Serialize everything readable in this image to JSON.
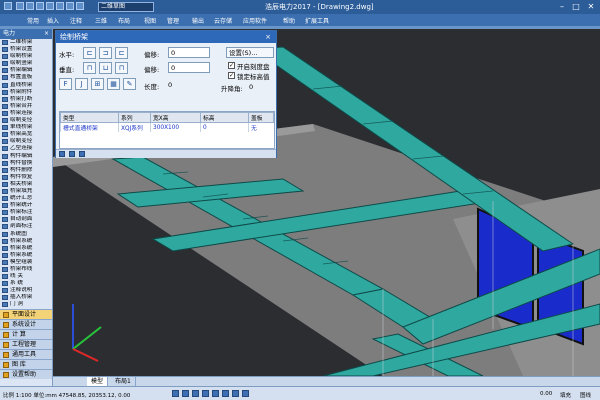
{
  "app": {
    "title": "浩辰电力2017 - [Drawing2.dwg]",
    "doc_dropdown": "二维草图",
    "win_min": "–",
    "win_max": "□",
    "win_close": "✕"
  },
  "menu": [
    "常用",
    "插入",
    "注释",
    "三维",
    "布局",
    "视图",
    "管理",
    "输出",
    "云存储",
    "应用软件",
    "帮助",
    "扩展工具"
  ],
  "sidebar": {
    "header": "电力",
    "close": "×",
    "items": [
      "二维桥架",
      "桥架设置",
      "绘制桥架",
      "绘制竖架",
      "桥架编辑",
      "布置盖板",
      "直线桥架",
      "桥架附件",
      "桥架打断",
      "桥架合并",
      "桥架连接",
      "绘制变径",
      "单线桥架",
      "桥架高宽",
      "绘制变径",
      "乙型连接",
      "构件编辑",
      "构件替换",
      "构件删除",
      "构件恢复",
      "相关桥架",
      "桥架填充",
      "统计汇总",
      "桥架统计",
      "桥架标注",
      "自动剖面",
      "剖面标注",
      "系统图",
      "桥架系统",
      "桥架系统",
      "桥架系统",
      "模型组装",
      "桥架布线",
      "线  关",
      "系  统",
      "注释说明",
      "插入桥架",
      "门  洞"
    ],
    "sections": [
      "平面设计",
      "系统设计",
      "计  算",
      "工程管理",
      "通用工具",
      "图  库",
      "设置帮助"
    ],
    "active_section": "平面设计"
  },
  "dialog": {
    "title": "绘制桥架",
    "close": "×",
    "h_label": "水平:",
    "v_label": "垂直:",
    "offset1_label": "偏移:",
    "offset1_value": "0",
    "offset2_label": "偏移:",
    "offset2_value": "0",
    "settings_btn": "设置(S)...",
    "opt1": "开启刻度盘",
    "opt2": "锁定标高值",
    "length_label": "长度:",
    "length_value": "0",
    "rise_label": "升降角:",
    "rise_value": "0",
    "columns": [
      "类型",
      "系列",
      "宽X高",
      "标高",
      "盖板"
    ],
    "rows": [
      [
        "槽式直通桥架",
        "XQJ系列",
        "300X100",
        "0",
        "无"
      ]
    ]
  },
  "tabs": [
    "模型",
    "布局1"
  ],
  "active_tab": "模型",
  "status": {
    "coord": "比例 1:100  单位:mm  47548.85, 20353.12, 0.00",
    "s1": "0.00",
    "s2": "填充",
    "s3": "图线"
  }
}
